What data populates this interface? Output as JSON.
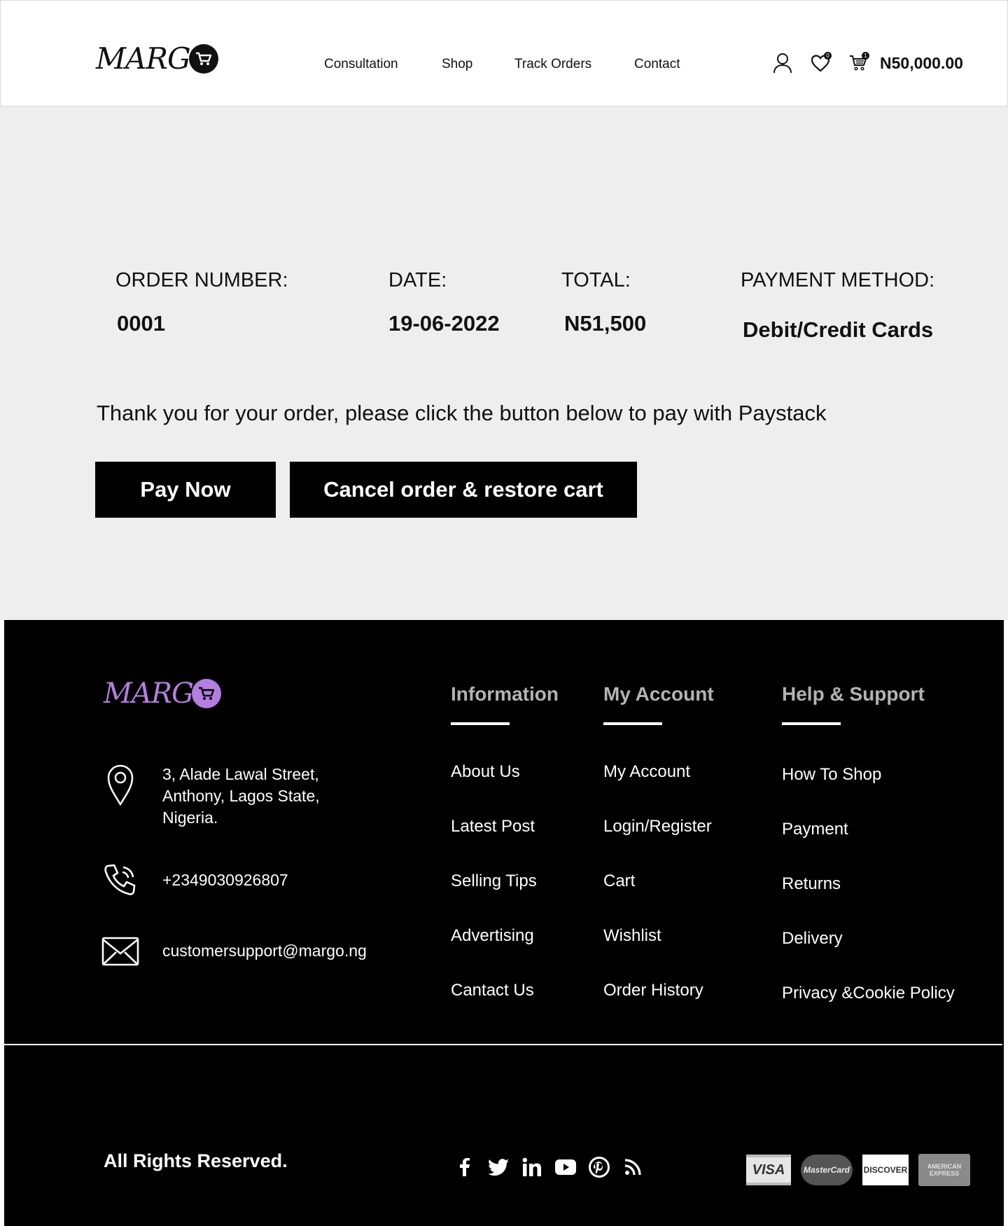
{
  "header": {
    "logo_text": "MARG",
    "nav": [
      "Consultation",
      "Shop",
      "Track Orders",
      "Contact"
    ],
    "wishlist_count": "0",
    "cart_count": "1",
    "cart_total": "N50,000.00"
  },
  "order": {
    "labels": {
      "order_number": "ORDER NUMBER:",
      "date": "DATE:",
      "total": "TOTAL:",
      "payment_method": "PAYMENT METHOD:"
    },
    "values": {
      "order_number": "0001",
      "date": "19-06-2022",
      "total": "N51,500",
      "payment_method": "Debit/Credit Cards"
    },
    "thanks_message": "Thank you for your order, please click the button below to pay with Paystack",
    "pay_now_label": "Pay Now",
    "cancel_label": "Cancel order & restore cart"
  },
  "footer": {
    "logo_text": "MARG",
    "accent_color": "#b47ee0",
    "address": [
      "3, Alade Lawal Street,",
      "Anthony, Lagos State,",
      "Nigeria."
    ],
    "phone": "+2349030926807",
    "email": "customersupport@margo.ng",
    "columns": [
      {
        "title": "Information",
        "links": [
          "About Us",
          "Latest Post",
          "Selling Tips",
          "Advertising",
          "Cantact Us"
        ]
      },
      {
        "title": "My Account",
        "links": [
          "My Account",
          "Login/Register",
          "Cart",
          "Wishlist",
          "Order History"
        ]
      },
      {
        "title": "Help & Support",
        "links": [
          "How To Shop",
          "Payment",
          "Returns",
          "Delivery",
          "Privacy &Cookie Policy"
        ]
      }
    ],
    "rights": "All Rights Reserved.",
    "socials": [
      "facebook-icon",
      "twitter-icon",
      "linkedin-icon",
      "youtube-icon",
      "pinterest-icon",
      "rss-icon"
    ],
    "payment_cards": [
      "VISA",
      "MasterCard",
      "DISCOVER",
      "AMERICAN EXPRESS"
    ]
  }
}
